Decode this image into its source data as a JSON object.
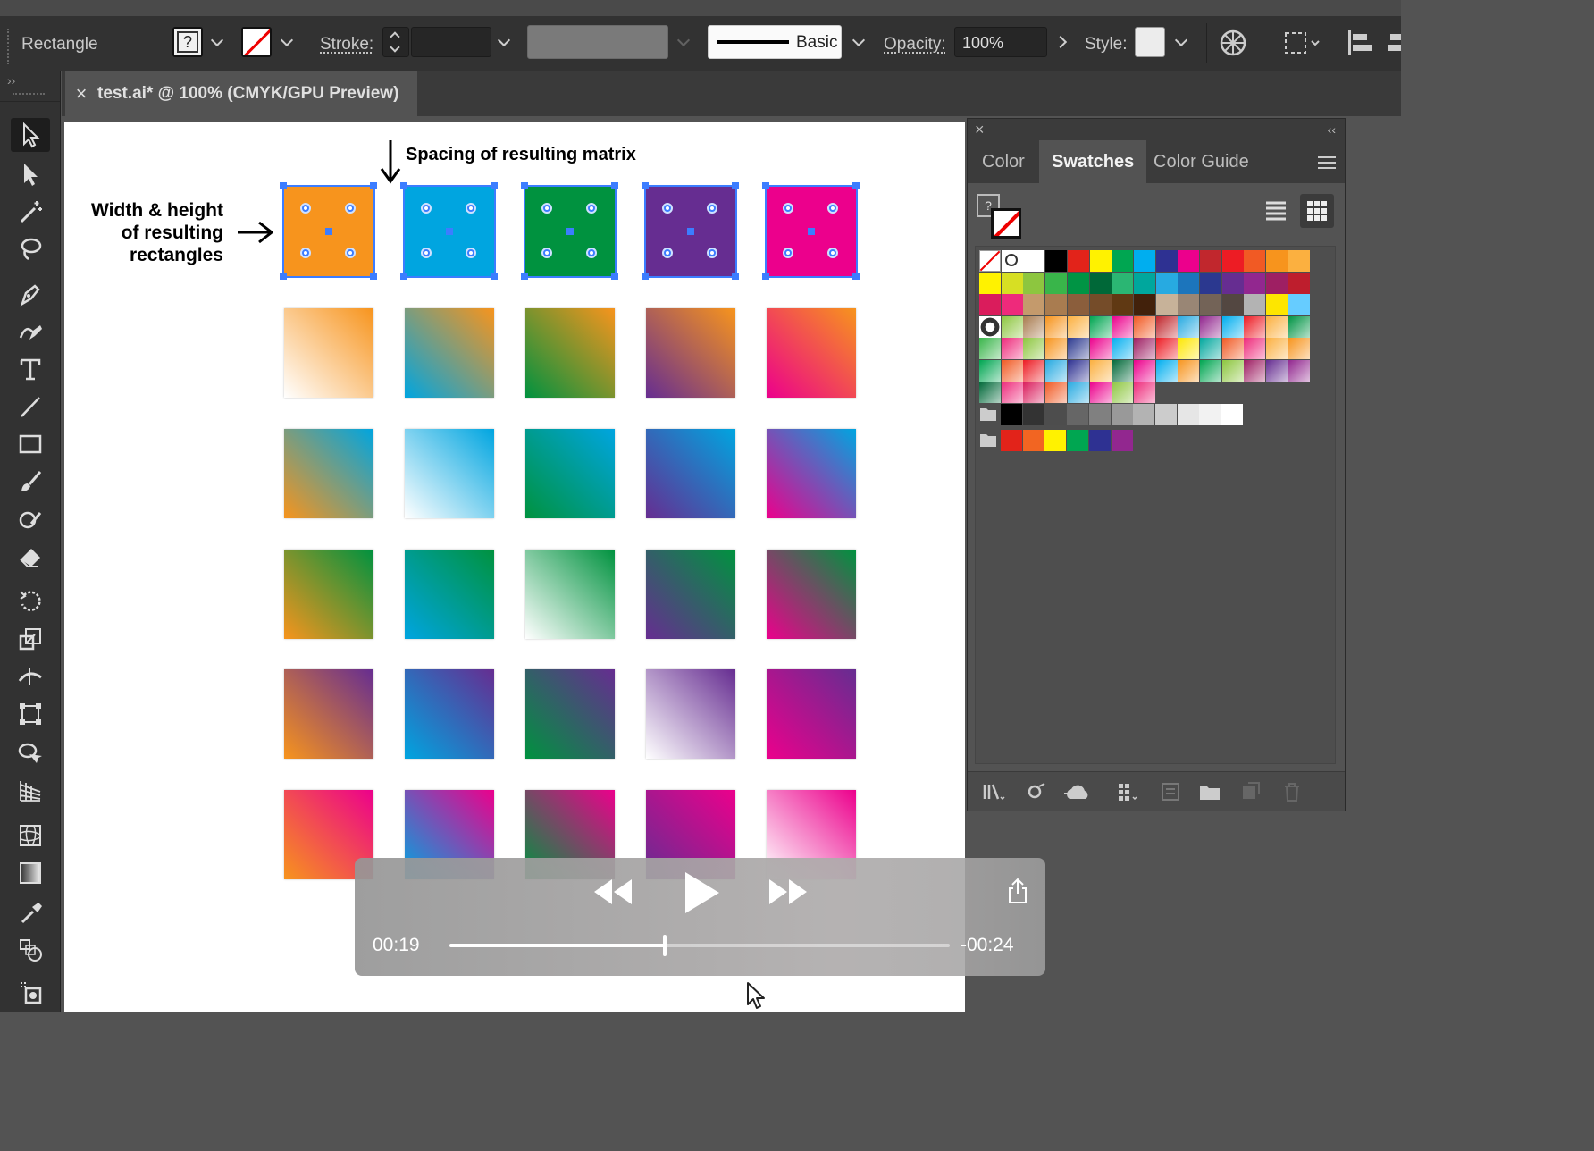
{
  "control_bar": {
    "selection_label": "Rectangle",
    "stroke_label": "Stroke:",
    "brush_label": "Basic",
    "opacity_label": "Opacity:",
    "opacity_value": "100%",
    "style_label": "Style:"
  },
  "document_tab": {
    "close": "×",
    "title": "test.ai* @ 100% (CMYK/GPU Preview)"
  },
  "artboard": {
    "annotation_top": "Spacing of resulting matrix",
    "annotation_left_lines": [
      "Width & height",
      "of resulting",
      "rectangles"
    ]
  },
  "panel": {
    "close": "×",
    "collapse": "‹‹",
    "tabs": [
      "Color",
      "Swatches",
      "Color Guide"
    ],
    "active_tab": "Swatches"
  },
  "player": {
    "elapsed": "00:19",
    "remaining": "-00:24",
    "progress": 0.43
  },
  "grid": {
    "top_row_colors": [
      "#f7941d",
      "#00a5e0",
      "#00923f",
      "#662d91",
      "#ec008c"
    ]
  },
  "colors": {
    "accent_selection": "#3c7dff",
    "ui_dark": "#323232",
    "canvas": "#535353"
  }
}
